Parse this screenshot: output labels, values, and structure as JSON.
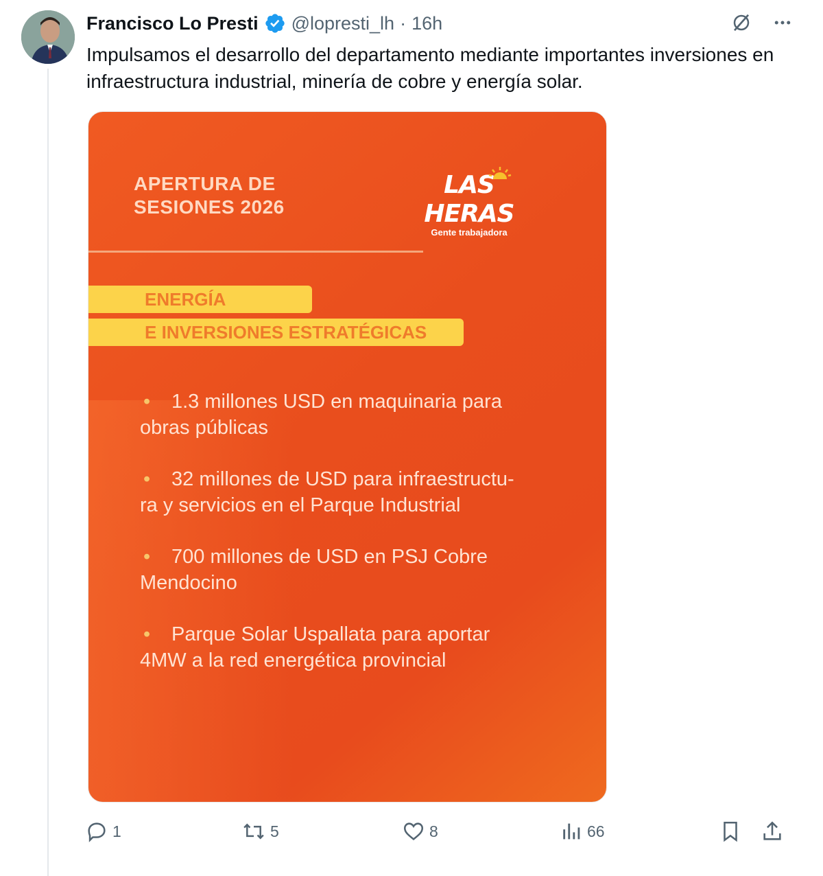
{
  "author": {
    "name": "Francisco Lo Presti",
    "handle": "@lopresti_lh",
    "separator": "·",
    "time": "16h"
  },
  "tweet": {
    "text": "Impulsamos el desarrollo del departamento mediante importantes inversiones en infraestructura industrial, minería de cobre y energía solar."
  },
  "card": {
    "heading_line1": "APERTURA DE",
    "heading_line2": "SESIONES 2026",
    "logo_text": "LAS HERAS",
    "logo_tagline": "Gente trabajadora",
    "band1": "ENERGÍA",
    "band2": "E INVERSIONES ESTRATÉGICAS",
    "bullet_symbol": "•",
    "bullets": [
      [
        "1.3 millones USD en maquinaria para",
        "obras públicas"
      ],
      [
        "32 millones de USD para infraestructu-",
        "ra y servicios en el Parque Industrial"
      ],
      [
        "700 millones de USD en PSJ Cobre",
        "Mendocino"
      ],
      [
        "Parque Solar Uspallata para aportar",
        "4MW a la red energética provincial"
      ]
    ],
    "colors": {
      "background": "#e94e1d",
      "band": "#fcd34a",
      "band_text": "#ef7b2b"
    }
  },
  "actions": {
    "replies": "1",
    "reposts": "5",
    "likes": "8",
    "views": "66"
  },
  "icons": [
    "verified-badge-icon",
    "grok-icon",
    "more-icon",
    "reply-icon",
    "repost-icon",
    "like-icon",
    "views-icon",
    "bookmark-icon",
    "share-icon"
  ]
}
